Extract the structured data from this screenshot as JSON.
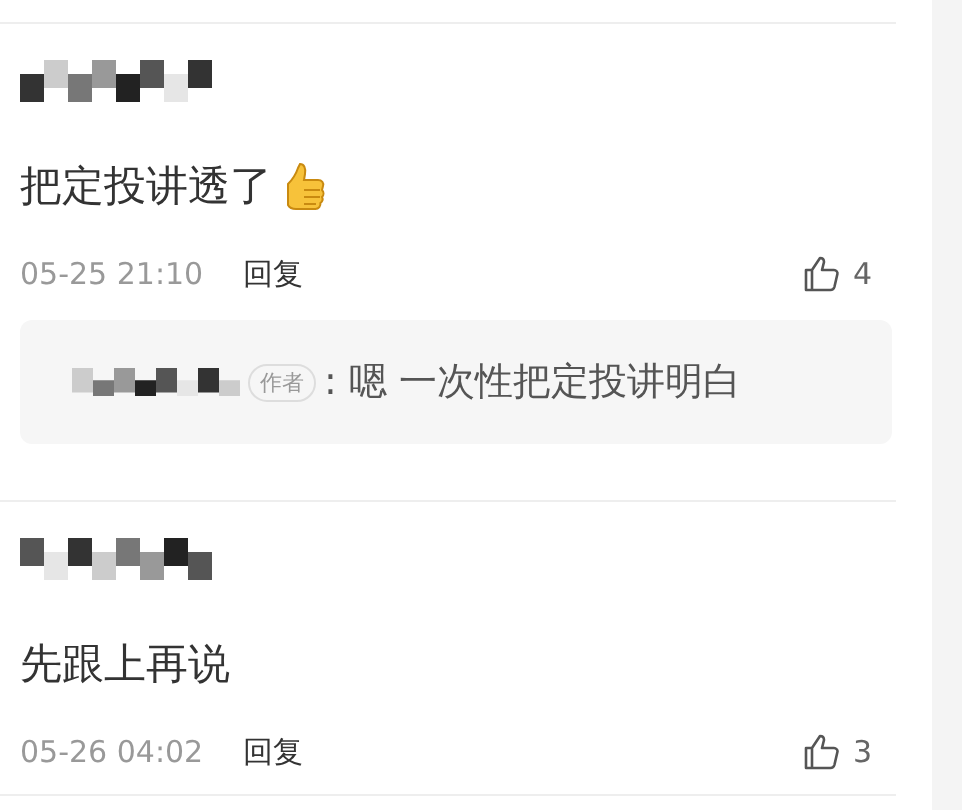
{
  "comments": [
    {
      "text": "把定投讲透了",
      "has_emoji": true,
      "time": "05-25 21:10",
      "reply_label": "回复",
      "likes": "4",
      "replies": [
        {
          "badge": "作者",
          "text": ": 嗯 一次性把定投讲明白"
        }
      ]
    },
    {
      "text": "先跟上再说",
      "has_emoji": false,
      "time": "05-26 04:02",
      "reply_label": "回复",
      "likes": "3"
    }
  ]
}
